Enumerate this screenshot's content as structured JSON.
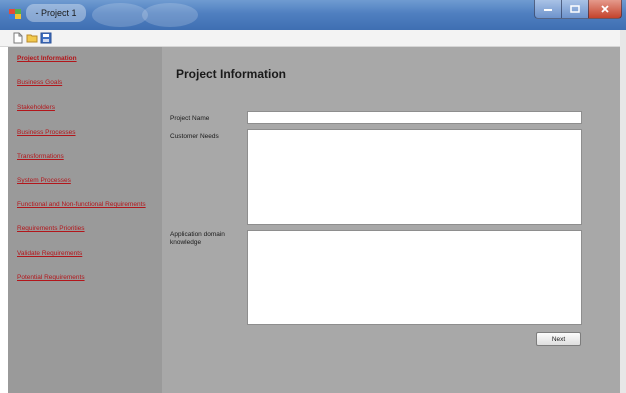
{
  "window": {
    "title": "- Project 1"
  },
  "toolbar": {
    "icons": [
      "new-document-icon",
      "open-folder-icon",
      "save-icon"
    ]
  },
  "sidebar": {
    "items": [
      {
        "label": "Project Information",
        "active": true
      },
      {
        "label": "Business Goals"
      },
      {
        "label": "Stakeholders"
      },
      {
        "label": "Business Processes"
      },
      {
        "label": "Transformations"
      },
      {
        "label": "System Processes"
      },
      {
        "label": "Functional and Non-functional Requirements"
      },
      {
        "label": "Requirements Priorities"
      },
      {
        "label": "Validate Requirements"
      },
      {
        "label": "Potential Requirements"
      }
    ]
  },
  "main": {
    "title": "Project Information",
    "project_name": {
      "label": "Project Name",
      "value": ""
    },
    "customer_needs": {
      "label": "Customer Needs",
      "value": ""
    },
    "domain_knowledge": {
      "label": "Application domain knowledge",
      "value": ""
    },
    "next_label": "Next"
  },
  "colors": {
    "sidebar_bg": "#9a9a9a",
    "content_bg": "#a8a8a8",
    "link": "#b3161b",
    "titlebar": "#4f7fc0"
  }
}
